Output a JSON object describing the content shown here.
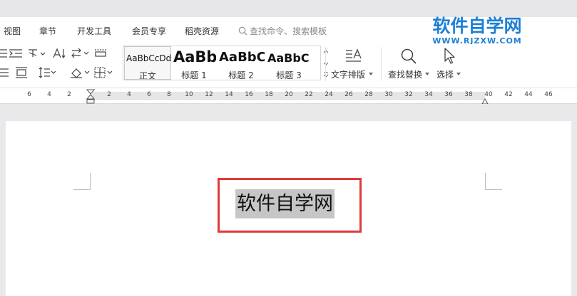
{
  "menubar": {
    "items": [
      "视图",
      "章节",
      "开发工具",
      "会员专享",
      "稻壳资源"
    ],
    "search_placeholder": "查找命令、搜索模板"
  },
  "watermark": {
    "name": "软件自学网",
    "url": "WWW.RJZXW.COM"
  },
  "styles": [
    {
      "sample": "AaBbCcDd",
      "name": "正文",
      "selected": true
    },
    {
      "sample": "AaBb",
      "name": "标题 1"
    },
    {
      "sample": "AaBbC",
      "name": "标题 2"
    },
    {
      "sample": "AaBbC",
      "name": "标题 3"
    }
  ],
  "tools": {
    "text_layout": "文字排版",
    "find_replace": "查找替换",
    "select": "选择"
  },
  "ruler": {
    "left_ticks": [
      "6",
      "4",
      "2"
    ],
    "right_ticks": [
      "2",
      "4",
      "6",
      "8",
      "10",
      "12",
      "14",
      "16",
      "18",
      "20",
      "22",
      "24",
      "26",
      "28",
      "30",
      "32",
      "34",
      "36",
      "38",
      "40",
      "42",
      "44",
      "46"
    ]
  },
  "document": {
    "selected_text": "软件自学网"
  },
  "colors": {
    "highlight_border": "#e03a3a",
    "selection_bg": "#c6c6c6",
    "watermark": "#1d7fd6"
  }
}
